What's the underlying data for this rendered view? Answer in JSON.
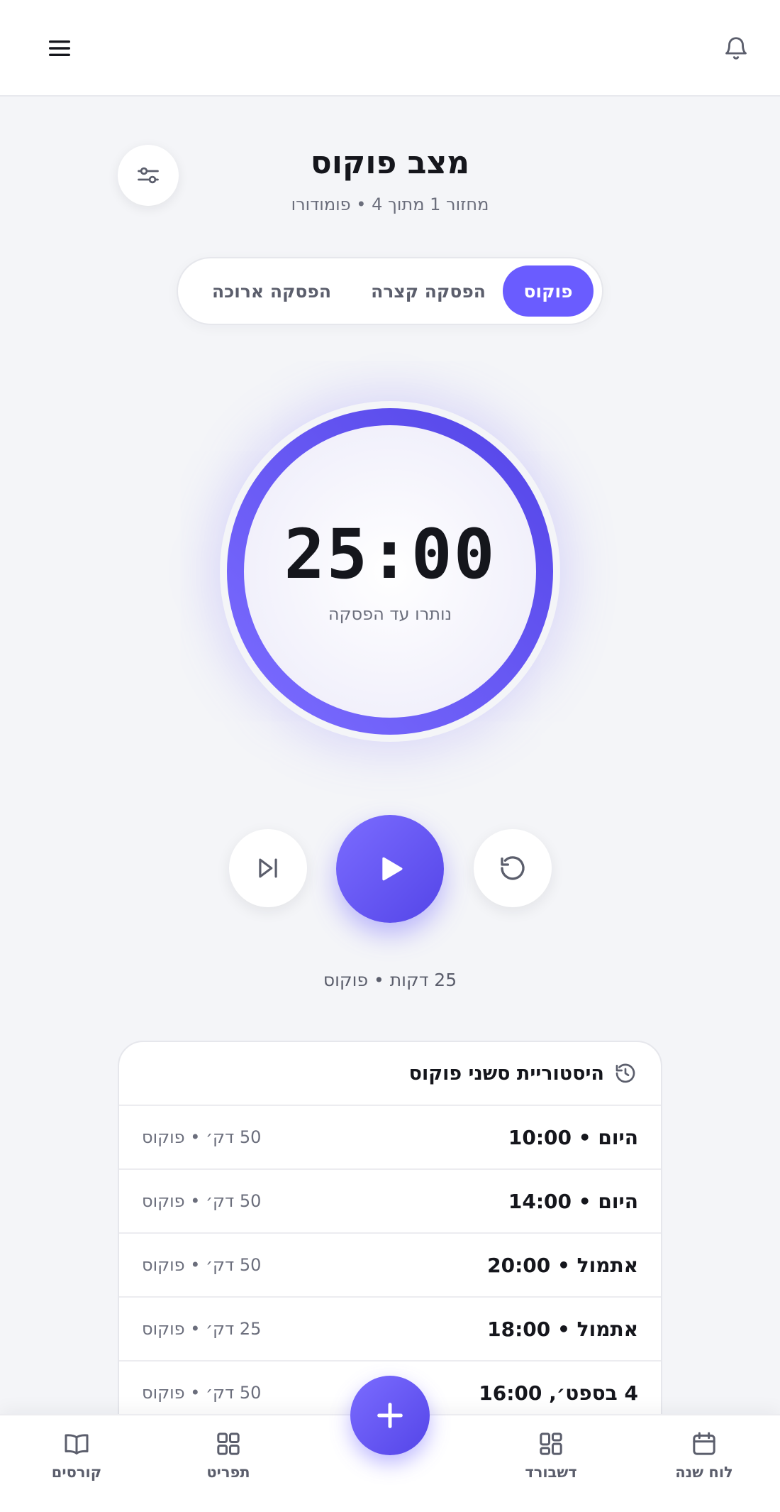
{
  "header": {
    "title": "מצב פוקוס",
    "subtitle": "מחזור 1 מתוך 4 • פומודורו"
  },
  "mode_tabs": [
    {
      "label": "פוקוס",
      "active": true
    },
    {
      "label": "הפסקה קצרה",
      "active": false
    },
    {
      "label": "הפסקה ארוכה",
      "active": false
    }
  ],
  "timer": {
    "time": "25:00",
    "caption": "נותרו עד הפסקה",
    "progress": 1.0
  },
  "session_info": "25 דקות • פוקוס",
  "history": {
    "title": "היסטוריית סשני פוקוס",
    "rows": [
      {
        "time": "היום • 10:00",
        "meta": "50 דק׳ • פוקוס"
      },
      {
        "time": "היום • 14:00",
        "meta": "50 דק׳ • פוקוס"
      },
      {
        "time": "אתמול • 20:00",
        "meta": "50 דק׳ • פוקוס"
      },
      {
        "time": "אתמול • 18:00",
        "meta": "25 דק׳ • פוקוס"
      },
      {
        "time": "4 בספט׳, 16:00",
        "meta": "50 דק׳ • פוקוס"
      }
    ]
  },
  "bottom_nav": {
    "calendar": "לוח שנה",
    "dashboard": "דשבורד",
    "menu": "תפריט",
    "courses": "קורסים"
  },
  "colors": {
    "accent": "#6a5cff",
    "background": "#f4f5f8",
    "text": "#15161c",
    "muted": "#6b6e7c"
  },
  "icons": [
    "menu-icon",
    "bell-icon",
    "sliders-icon",
    "reset-icon",
    "play-icon",
    "skip-icon",
    "history-icon",
    "calendar-icon",
    "dashboard-icon",
    "grid-icon",
    "book-icon",
    "plus-icon"
  ]
}
